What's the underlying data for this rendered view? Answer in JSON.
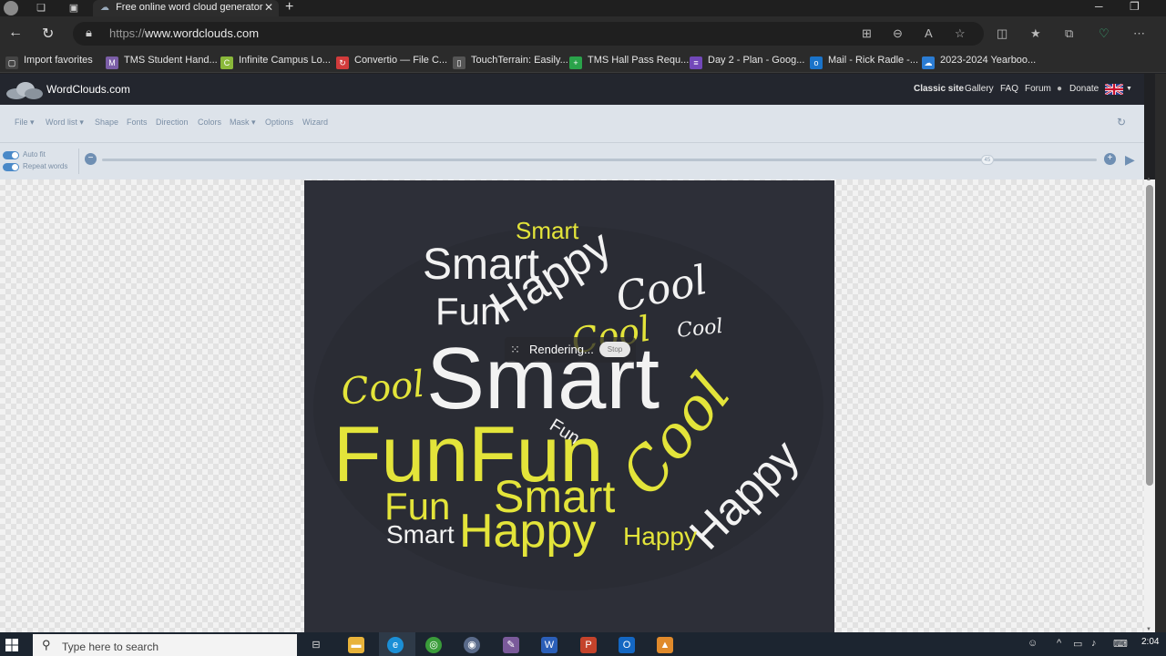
{
  "browser": {
    "tab_title": "Free online word cloud generator",
    "tab_close": "✕",
    "new_tab": "+",
    "url_protocol": "https://",
    "url_host": "www.wordclouds.com"
  },
  "favorites": [
    {
      "label": "Import favorites",
      "icon": "folder-icon",
      "color": "#444444",
      "glyph": "▢"
    },
    {
      "label": "TMS Student Hand...",
      "icon": "m-icon",
      "color": "#7b5ea7",
      "glyph": "M"
    },
    {
      "label": "Infinite Campus Lo...",
      "icon": "campus-icon",
      "color": "#8ab83a",
      "glyph": "C"
    },
    {
      "label": "Convertio — File C...",
      "icon": "convertio-icon",
      "color": "#d23b3b",
      "glyph": "↻"
    },
    {
      "label": "TouchTerrain: Easily...",
      "icon": "page-icon",
      "color": "#555555",
      "glyph": "▯"
    },
    {
      "label": "TMS Hall Pass Requ...",
      "icon": "plus-icon",
      "color": "#2aa34a",
      "glyph": "+"
    },
    {
      "label": "Day 2 - Plan - Goog...",
      "icon": "form-icon",
      "color": "#7248b9",
      "glyph": "≡"
    },
    {
      "label": "Mail - Rick Radle -...",
      "icon": "outlook-icon",
      "color": "#1a73c9",
      "glyph": "o"
    },
    {
      "label": "2023-2024 Yearboo...",
      "icon": "onedrive-icon",
      "color": "#2b7cd3",
      "glyph": "☁"
    }
  ],
  "site": {
    "brand": "WordClouds.com",
    "nav": [
      "Classic site",
      "Gallery",
      "FAQ",
      "Forum",
      "Donate"
    ]
  },
  "toolbar": {
    "menu": [
      {
        "label": "File",
        "caret": true
      },
      {
        "label": "Word list",
        "caret": true
      },
      {
        "label": "Shape",
        "caret": false
      },
      {
        "label": "Fonts",
        "caret": false
      },
      {
        "label": "Direction",
        "caret": false
      },
      {
        "label": "Colors",
        "caret": false
      },
      {
        "label": "Mask",
        "caret": true
      },
      {
        "label": "Options",
        "caret": false
      },
      {
        "label": "Wizard",
        "caret": false
      }
    ]
  },
  "controls": {
    "auto_fit": "Auto fit",
    "repeat_words": "Repeat words",
    "slider_value": "45",
    "slider_fraction": 0.89
  },
  "canvas": {
    "rendering_text": "Rendering...",
    "stop_label": "Stop",
    "background": "#2d2f38",
    "colors": {
      "yellow": "#e3e43a",
      "white": "#f2f2f2"
    }
  },
  "cloud_words": [
    {
      "text": "Smart",
      "font": "sans",
      "color": "yellow"
    },
    {
      "text": "Smart",
      "font": "sans",
      "color": "white"
    },
    {
      "text": "Happy",
      "font": "sans",
      "color": "white"
    },
    {
      "text": "Cool",
      "font": "script",
      "color": "white"
    },
    {
      "text": "Fun",
      "font": "sans",
      "color": "white"
    },
    {
      "text": "Cool",
      "font": "script",
      "color": "yellow"
    },
    {
      "text": "Cool",
      "font": "script",
      "color": "white"
    },
    {
      "text": "Cool",
      "font": "script",
      "color": "yellow"
    },
    {
      "text": "Smart",
      "font": "sans",
      "color": "white"
    },
    {
      "text": "Cool",
      "font": "script",
      "color": "yellow"
    },
    {
      "text": "Fun",
      "font": "sans",
      "color": "white"
    },
    {
      "text": "FunFun",
      "font": "sans",
      "color": "yellow"
    },
    {
      "text": "Happy",
      "font": "sans",
      "color": "white"
    },
    {
      "text": "Fun",
      "font": "sans",
      "color": "yellow"
    },
    {
      "text": "Smart",
      "font": "sans",
      "color": "yellow"
    },
    {
      "text": "Smart",
      "font": "sans",
      "color": "white"
    },
    {
      "text": "Happy",
      "font": "sans",
      "color": "yellow"
    },
    {
      "text": "Happy",
      "font": "sans",
      "color": "yellow"
    }
  ],
  "taskbar": {
    "search_placeholder": "Type here to search",
    "time": "2:04"
  }
}
